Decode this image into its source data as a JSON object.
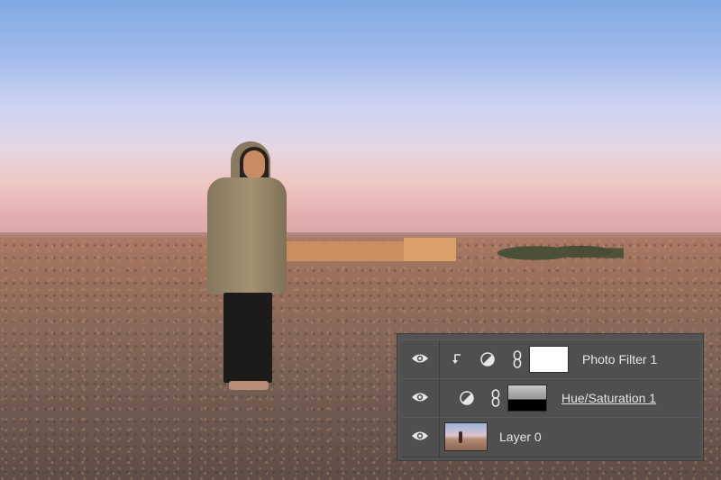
{
  "canvas": {
    "description": "Woman in hooded olive parka standing in desert at sunset, caravanserai and trees in background"
  },
  "layers_panel": {
    "layers": [
      {
        "name": "Photo Filter 1",
        "visible": true,
        "clipped": true,
        "type": "adjustment",
        "adjustment_icon": "half-circle-adjustment-icon",
        "linked_mask": true,
        "mask": "white",
        "active": false
      },
      {
        "name": "Hue/Saturation 1",
        "visible": true,
        "clipped": false,
        "type": "adjustment",
        "adjustment_icon": "half-circle-adjustment-icon",
        "linked_mask": true,
        "mask": "silhouette-mask",
        "active": true
      },
      {
        "name": "Layer 0",
        "visible": true,
        "clipped": false,
        "type": "pixel",
        "thumbnail": "photo"
      }
    ]
  },
  "colors": {
    "panel_bg": "#535353",
    "row_bg": "#4f4f4f",
    "text": "#e6e6e6"
  }
}
